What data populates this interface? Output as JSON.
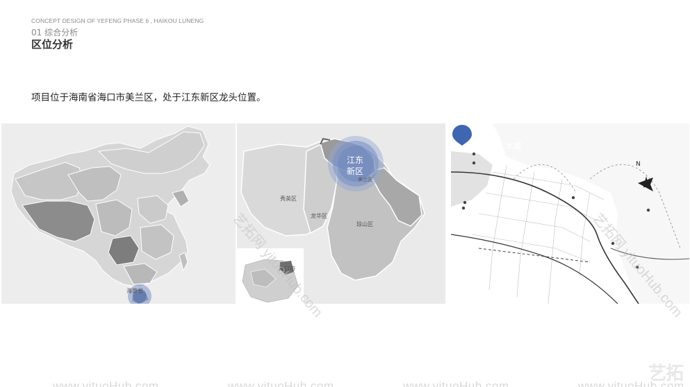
{
  "header": {
    "concept": "CONCEPT DESIGN OF YEFENG PHASE 6 , HAIKOU LUNENG",
    "section": "01 综合分析",
    "title": "区位分析"
  },
  "description": "项目位于海南省海口市美兰区，处于江东新区龙头位置。",
  "map_china": {
    "province_label": "海南省"
  },
  "map_haikou": {
    "highlight_label_line1": "江东",
    "highlight_label_line2": "新区",
    "district_xiuying": "秀英区",
    "district_longhua": "龙华区",
    "district_qiongshan": "琼山区",
    "district_meilan": "美兰区",
    "inset_label": "海口市"
  },
  "map_site": {
    "pin_label": "本案",
    "compass_label": "N"
  },
  "watermark": {
    "url": "www.yituoHub.com",
    "diag1": "艺拓网 yituoHub.com",
    "diag2": "艺拓网 yituoHub.com",
    "logo": "艺拓"
  }
}
